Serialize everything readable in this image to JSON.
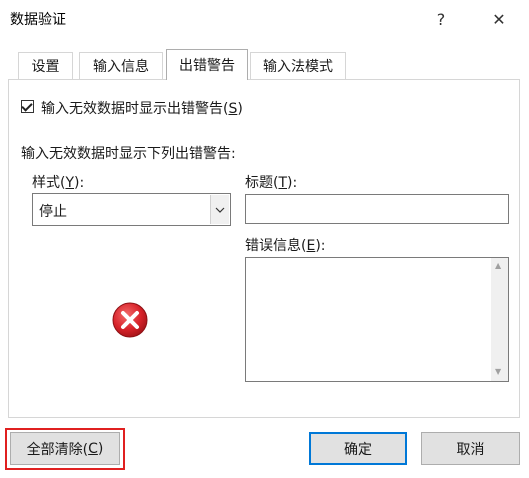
{
  "window": {
    "title": "数据验证",
    "help_glyph": "?",
    "close_glyph": "✕"
  },
  "tabs": [
    {
      "label": "设置",
      "active": false
    },
    {
      "label": "输入信息",
      "active": false
    },
    {
      "label": "出错警告",
      "active": true
    },
    {
      "label": "输入法模式",
      "active": false
    }
  ],
  "show_error_checkbox": {
    "checked": true,
    "label_prefix": "输入无效数据时显示出错警告(",
    "accelerator": "S",
    "label_suffix": ")"
  },
  "section_heading": "输入无效数据时显示下列出错警告:",
  "style_field": {
    "label_prefix": "样式(",
    "accelerator": "Y",
    "label_suffix": "):",
    "value": "停止"
  },
  "title_field": {
    "label_prefix": "标题(",
    "accelerator": "T",
    "label_suffix": "):",
    "value": ""
  },
  "error_message_field": {
    "label_prefix": "错误信息(",
    "accelerator": "E",
    "label_suffix": "):",
    "value": ""
  },
  "icon": {
    "name": "error-stop-icon",
    "color": "#d8232a"
  },
  "buttons": {
    "clear_all": {
      "prefix": "全部清除(",
      "accelerator": "C",
      "suffix": ")"
    },
    "ok": "确定",
    "cancel": "取消"
  },
  "colors": {
    "highlight": "#e02020",
    "primary_border": "#0078d7"
  }
}
